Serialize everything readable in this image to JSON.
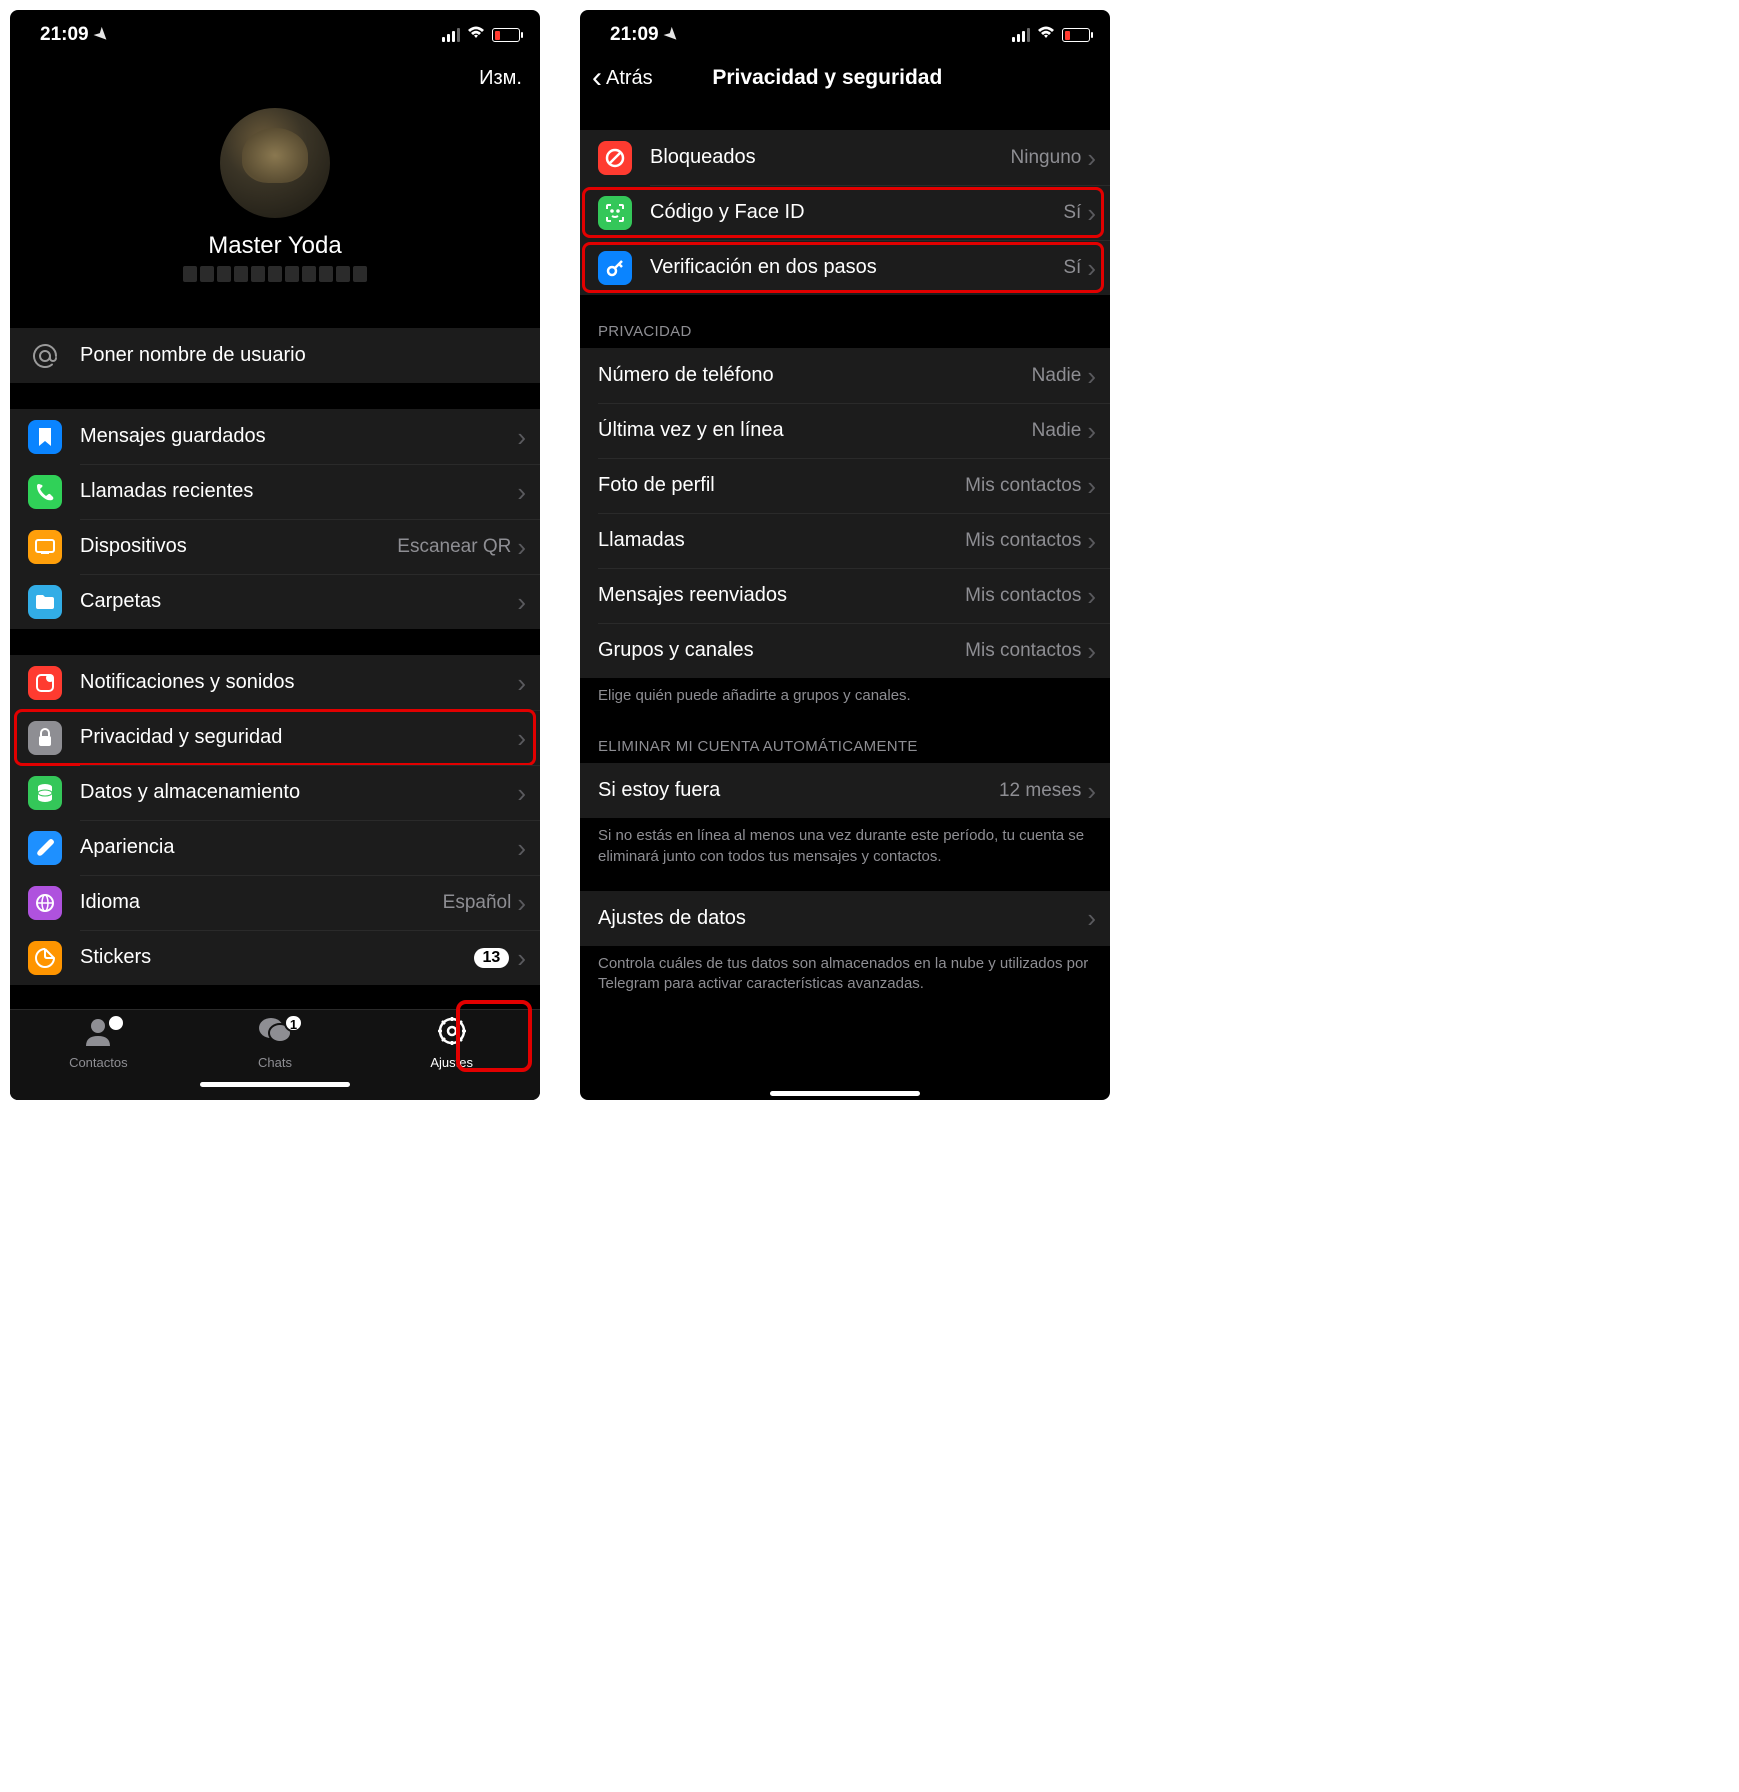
{
  "status": {
    "time": "21:09"
  },
  "left": {
    "edit": "Изм.",
    "profile_name": "Master Yoda",
    "rows": {
      "username": "Poner nombre de usuario",
      "saved": "Mensajes guardados",
      "calls": "Llamadas recientes",
      "devices": "Dispositivos",
      "devices_detail": "Escanear QR",
      "folders": "Carpetas",
      "notifications": "Notificaciones y sonidos",
      "privacy": "Privacidad y seguridad",
      "data": "Datos y almacenamiento",
      "appearance": "Apariencia",
      "language": "Idioma",
      "language_detail": "Español",
      "stickers": "Stickers",
      "stickers_badge": "13"
    },
    "tabs": {
      "contacts": "Contactos",
      "chats": "Chats",
      "chats_badge": "1",
      "settings": "Ajustes"
    }
  },
  "right": {
    "back": "Atrás",
    "title": "Privacidad y seguridad",
    "security": {
      "blocked": "Bloqueados",
      "blocked_val": "Ninguno",
      "passcode": "Código y Face ID",
      "passcode_val": "Sí",
      "twostep": "Verificación en dos pasos",
      "twostep_val": "Sí"
    },
    "privacy_header": "Privacidad",
    "privacy": {
      "phone": "Número de teléfono",
      "phone_val": "Nadie",
      "lastseen": "Última vez y en línea",
      "lastseen_val": "Nadie",
      "photo": "Foto de perfil",
      "photo_val": "Mis contactos",
      "calls": "Llamadas",
      "calls_val": "Mis contactos",
      "forward": "Mensajes reenviados",
      "forward_val": "Mis contactos",
      "groups": "Grupos y canales",
      "groups_val": "Mis contactos"
    },
    "privacy_footer": "Elige quién puede añadirte a grupos y canales.",
    "delete_header": "Eliminar mi cuenta automáticamente",
    "delete": {
      "away": "Si estoy fuera",
      "away_val": "12 meses"
    },
    "delete_footer": "Si no estás en línea al menos una vez durante este período, tu cuenta se eliminará junto con todos tus mensajes y contactos.",
    "datasettings": "Ajustes de datos",
    "datasettings_footer": "Controla cuáles de tus datos son almacenados en la nube y utilizados por Telegram para activar características avanzadas."
  }
}
